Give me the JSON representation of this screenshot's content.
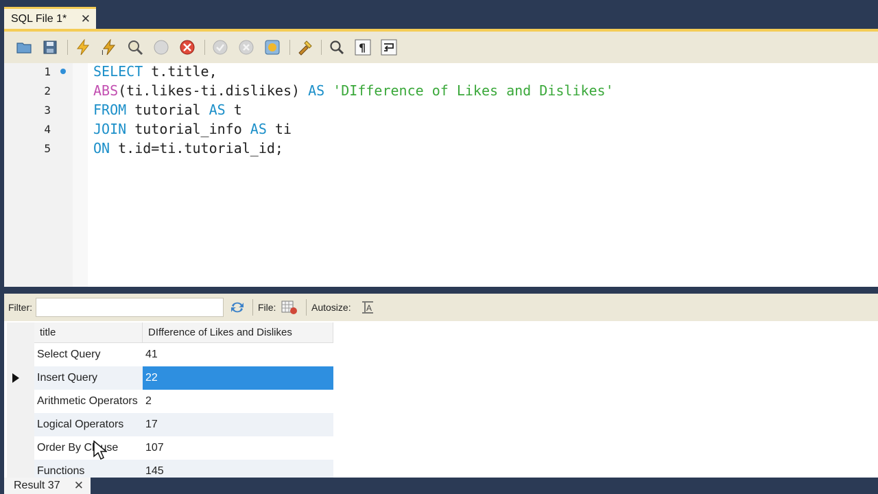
{
  "tab": {
    "title": "SQL File 1*",
    "close": "✕"
  },
  "toolbar": {
    "icons": [
      "open-folder-icon",
      "save-icon",
      "execute-icon",
      "execute-current-icon",
      "explain-icon",
      "stop-icon",
      "toggle-error-icon",
      "commit-icon",
      "rollback-icon",
      "autocommit-icon",
      "beautify-icon",
      "find-icon",
      "invisible-chars-icon",
      "word-wrap-icon"
    ]
  },
  "editor": {
    "line_numbers": [
      "1",
      "2",
      "3",
      "4",
      "5"
    ],
    "lines": [
      [
        {
          "t": "SELECT",
          "c": "kw"
        },
        {
          "t": " t.title,",
          "c": ""
        }
      ],
      [
        {
          "t": "ABS",
          "c": "fn"
        },
        {
          "t": "(ti.likes-ti.dislikes) ",
          "c": ""
        },
        {
          "t": "AS",
          "c": "kw"
        },
        {
          "t": " ",
          "c": ""
        },
        {
          "t": "'DIfference of Likes and Dislikes'",
          "c": "str"
        }
      ],
      [
        {
          "t": "FROM",
          "c": "kw"
        },
        {
          "t": " tutorial ",
          "c": ""
        },
        {
          "t": "AS",
          "c": "kw"
        },
        {
          "t": " t",
          "c": ""
        }
      ],
      [
        {
          "t": "JOIN",
          "c": "kw"
        },
        {
          "t": " tutorial_info ",
          "c": ""
        },
        {
          "t": "AS",
          "c": "kw"
        },
        {
          "t": " ti",
          "c": ""
        }
      ],
      [
        {
          "t": "ON",
          "c": "kw"
        },
        {
          "t": " t.id=ti.tutorial_id;",
          "c": ""
        }
      ]
    ]
  },
  "results": {
    "filter_label": "Filter:",
    "filter_value": "",
    "file_label": "File:",
    "autosize_label": "Autosize:",
    "columns": [
      "title",
      "DIfference of Likes and Dislikes"
    ],
    "rows": [
      [
        "Select Query",
        "41"
      ],
      [
        "Insert Query",
        "22"
      ],
      [
        "Arithmetic Operators",
        "2"
      ],
      [
        "Logical Operators",
        "17"
      ],
      [
        "Order By Clause",
        "107"
      ],
      [
        "Functions",
        "145"
      ]
    ],
    "selected_row": 1
  },
  "result_tab": {
    "title": "Result 37",
    "close": "✕"
  },
  "colors": {
    "accent": "#f5cc55",
    "keyword": "#1b8fc9",
    "function": "#c24fb1",
    "string": "#3aa83a",
    "selection": "#2e8fe0",
    "chrome": "#2b3a55"
  }
}
